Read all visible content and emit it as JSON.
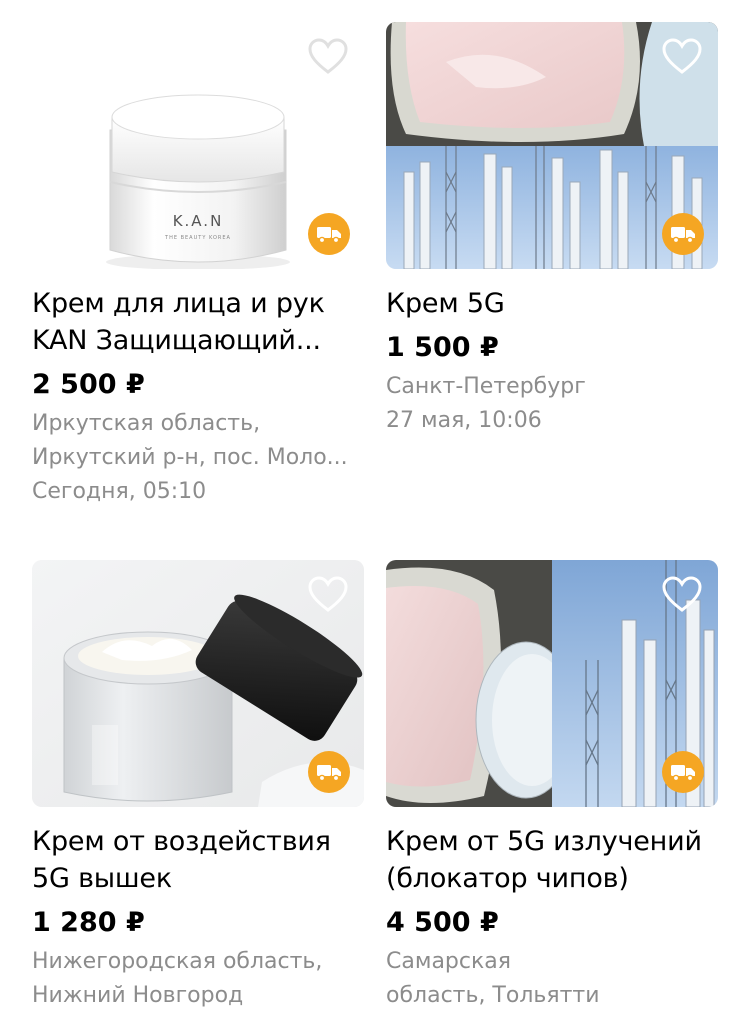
{
  "listings": [
    {
      "title_lines": [
        "Крем для лица и рук",
        "KAN Защищающий..."
      ],
      "price": "2 500 ₽",
      "location_lines": [
        "Иркутская область,",
        "Иркутский р-н, пос. Моло..."
      ],
      "date": "Сегодня, 05:10",
      "jar_brand": "K.A.N",
      "jar_subtitle": "THE BEAUTY KOREA",
      "favorite_icon": "heart-outline-icon",
      "delivery_icon": "truck-icon"
    },
    {
      "title_lines": [
        "Крем 5G"
      ],
      "price": "1 500 ₽",
      "location_lines": [
        "Санкт-Петербург"
      ],
      "date": "27 мая, 10:06",
      "favorite_icon": "heart-outline-icon",
      "delivery_icon": "truck-icon"
    },
    {
      "title_lines": [
        "Крем от воздействия",
        "5G вышек"
      ],
      "price": "1 280 ₽",
      "location_lines": [
        "Нижегородская область,",
        "Нижний Новгород"
      ],
      "favorite_icon": "heart-outline-icon",
      "delivery_icon": "truck-icon"
    },
    {
      "title_lines": [
        "Крем от 5G излучений",
        "(блокатор чипов)"
      ],
      "price": "4 500 ₽",
      "location_lines": [
        "Самарская",
        "область, Тольятти"
      ],
      "favorite_icon": "heart-outline-icon",
      "delivery_icon": "truck-icon"
    }
  ],
  "colors": {
    "price": "#000000",
    "meta": "#8c8c8c",
    "delivery_badge": "#f5a623"
  }
}
